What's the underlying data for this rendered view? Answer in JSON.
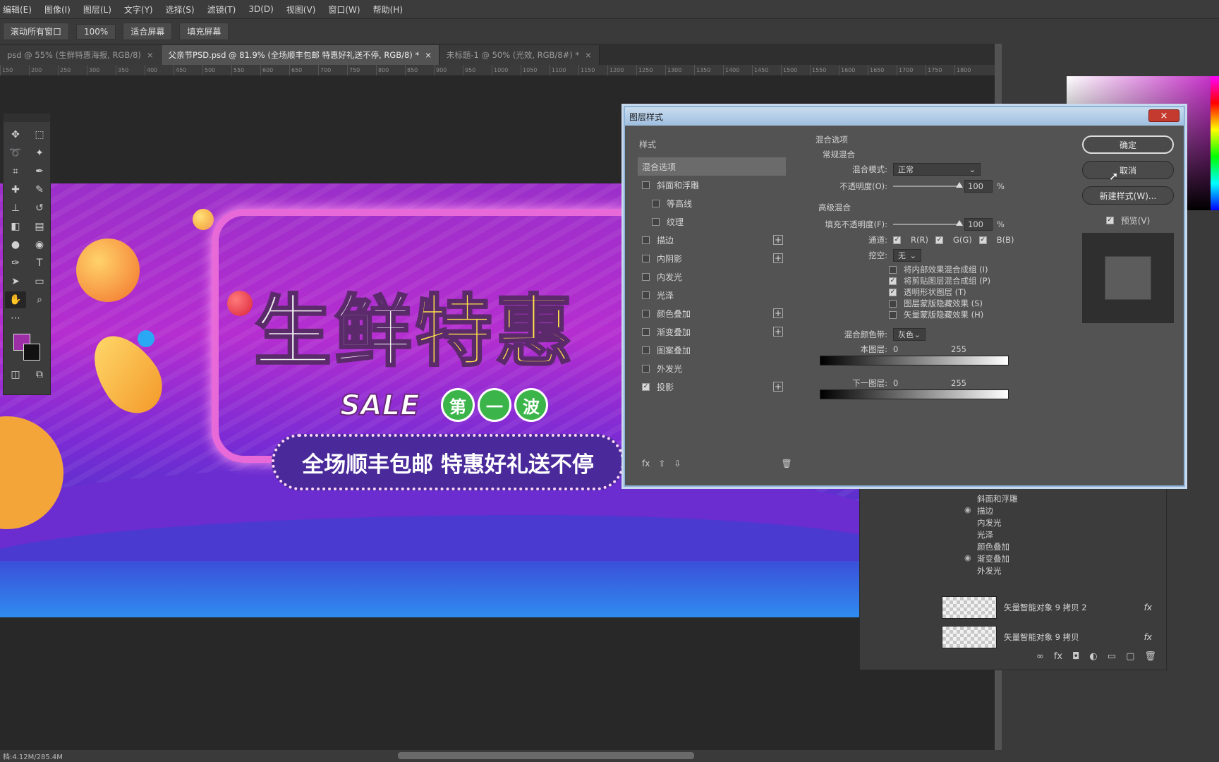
{
  "menu": [
    "编辑(E)",
    "图像(I)",
    "图层(L)",
    "文字(Y)",
    "选择(S)",
    "滤镜(T)",
    "3D(D)",
    "视图(V)",
    "窗口(W)",
    "帮助(H)"
  ],
  "options": {
    "scroll_all": "滚动所有窗口",
    "zoom": "100%",
    "fit": "适合屏幕",
    "fill": "填充屏幕"
  },
  "tabs": [
    {
      "label": "psd @ 55% (生鲜特惠海报, RGB/8)",
      "close": "×"
    },
    {
      "label": "父亲节PSD.psd @ 81.9% (全场顺丰包邮 特惠好礼送不停, RGB/8) *",
      "close": "×"
    },
    {
      "label": "未标题-1 @ 50% (光效, RGB/8#) *",
      "close": "×"
    }
  ],
  "ruler_ticks": [
    "150",
    "200",
    "250",
    "300",
    "350",
    "400",
    "450",
    "500",
    "550",
    "600",
    "650",
    "700",
    "750",
    "800",
    "850",
    "900",
    "950",
    "1000",
    "1050",
    "1100",
    "1150",
    "1200",
    "1250",
    "1300",
    "1350",
    "1400",
    "1450",
    "1500",
    "1550",
    "1600",
    "1650",
    "1700",
    "1750",
    "1800"
  ],
  "banner": {
    "title_white": "生鲜",
    "title_yellow": "特惠",
    "sale": "SALE",
    "badges": [
      "第",
      "一",
      "波"
    ],
    "slogan": "全场顺丰包邮 特惠好礼送不停"
  },
  "dialog": {
    "title": "图层样式",
    "close": "×",
    "styles_header": "样式",
    "styles": [
      {
        "label": "混合选项",
        "checkbox": false,
        "checked": false,
        "plus": false,
        "selected": true,
        "indent": false
      },
      {
        "label": "斜面和浮雕",
        "checkbox": true,
        "checked": false,
        "plus": false,
        "selected": false,
        "indent": false
      },
      {
        "label": "等高线",
        "checkbox": true,
        "checked": false,
        "plus": false,
        "selected": false,
        "indent": true
      },
      {
        "label": "纹理",
        "checkbox": true,
        "checked": false,
        "plus": false,
        "selected": false,
        "indent": true
      },
      {
        "label": "描边",
        "checkbox": true,
        "checked": false,
        "plus": true,
        "selected": false,
        "indent": false
      },
      {
        "label": "内阴影",
        "checkbox": true,
        "checked": false,
        "plus": true,
        "selected": false,
        "indent": false
      },
      {
        "label": "内发光",
        "checkbox": true,
        "checked": false,
        "plus": false,
        "selected": false,
        "indent": false
      },
      {
        "label": "光泽",
        "checkbox": true,
        "checked": false,
        "plus": false,
        "selected": false,
        "indent": false
      },
      {
        "label": "颜色叠加",
        "checkbox": true,
        "checked": false,
        "plus": true,
        "selected": false,
        "indent": false
      },
      {
        "label": "渐变叠加",
        "checkbox": true,
        "checked": false,
        "plus": true,
        "selected": false,
        "indent": false
      },
      {
        "label": "图案叠加",
        "checkbox": true,
        "checked": false,
        "plus": false,
        "selected": false,
        "indent": false
      },
      {
        "label": "外发光",
        "checkbox": true,
        "checked": false,
        "plus": false,
        "selected": false,
        "indent": false
      },
      {
        "label": "投影",
        "checkbox": true,
        "checked": true,
        "plus": true,
        "selected": false,
        "indent": false
      }
    ],
    "footer_icons": [
      "fx",
      "⇧",
      "⇩",
      "🗑"
    ],
    "blend_options": "混合选项",
    "general_blend": "常规混合",
    "blend_mode_label": "混合模式:",
    "blend_mode_value": "正常",
    "opacity_label": "不透明度(O):",
    "opacity_value": "100",
    "percent": "%",
    "advanced_blend": "高级混合",
    "fill_opacity_label": "填充不透明度(F):",
    "fill_opacity_value": "100",
    "channels_label": "通道:",
    "channel_r": "R(R)",
    "channel_g": "G(G)",
    "channel_b": "B(B)",
    "knockout_label": "挖空:",
    "knockout_value": "无",
    "adv_options": [
      {
        "label": "将内部效果混合成组 (I)",
        "checked": false
      },
      {
        "label": "将剪贴图层混合成组 (P)",
        "checked": true
      },
      {
        "label": "透明形状图层 (T)",
        "checked": true
      },
      {
        "label": "图层蒙版隐藏效果 (S)",
        "checked": false
      },
      {
        "label": "矢量蒙版隐藏效果 (H)",
        "checked": false
      }
    ],
    "blend_if_label": "混合颜色带:",
    "blend_if_value": "灰色",
    "this_layer_label": "本图层:",
    "this_layer_min": "0",
    "this_layer_max": "255",
    "underlying_label": "下一图层:",
    "underlying_min": "0",
    "underlying_max": "255",
    "ok": "确定",
    "cancel": "取消",
    "new_style": "新建样式(W)...",
    "preview_label": "预览(V)"
  },
  "layers": {
    "fx_items": [
      {
        "label": "斜面和浮雕",
        "eye": false
      },
      {
        "label": "描边",
        "eye": true
      },
      {
        "label": "内发光",
        "eye": false
      },
      {
        "label": "光泽",
        "eye": false
      },
      {
        "label": "颜色叠加",
        "eye": false
      },
      {
        "label": "渐变叠加",
        "eye": true
      },
      {
        "label": "外发光",
        "eye": false
      }
    ],
    "rows": [
      {
        "name": "矢量智能对象 9 拷贝 2",
        "fx": "fx"
      },
      {
        "name": "矢量智能对象 9 拷贝",
        "fx": "fx"
      }
    ],
    "footer": [
      "∞",
      "fx",
      "◘",
      "◐",
      "▭",
      "▢",
      "🗑"
    ]
  },
  "status": {
    "doc": "档:4.12M/285.4M"
  },
  "colors": {
    "fg": "#9c2fa6",
    "bg": "#111111"
  }
}
